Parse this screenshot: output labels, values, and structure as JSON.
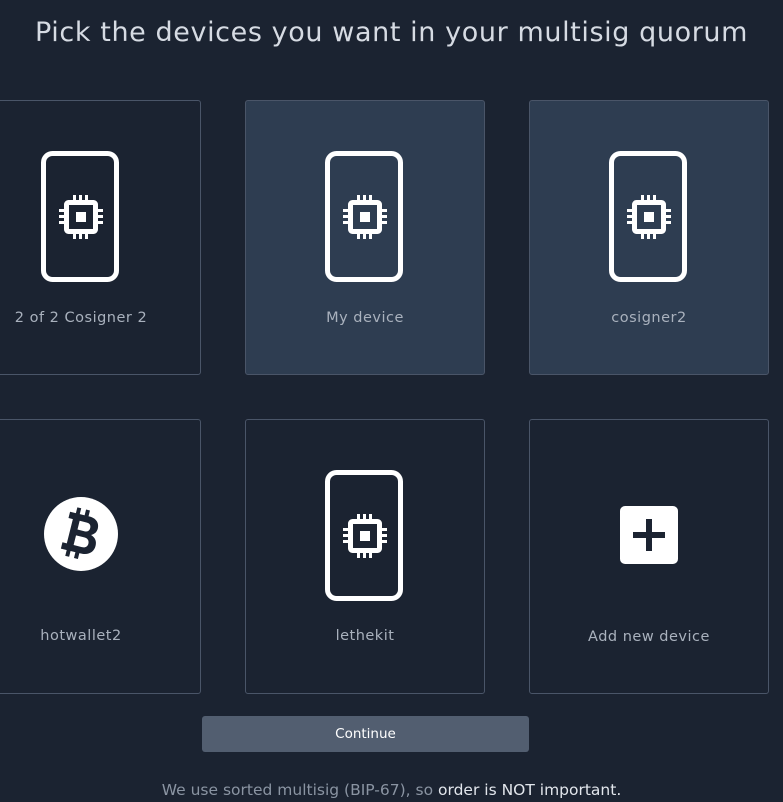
{
  "page": {
    "title": "Pick the devices you want in your multisig quorum"
  },
  "devices": [
    {
      "label": "2 of 2 Cosigner 2",
      "icon": "chip-device-icon",
      "selected": false
    },
    {
      "label": "My device",
      "icon": "chip-device-icon",
      "selected": true
    },
    {
      "label": "cosigner2",
      "icon": "chip-device-icon",
      "selected": true
    },
    {
      "label": "hotwallet2",
      "icon": "bitcoin-icon",
      "selected": false
    },
    {
      "label": "lethekit",
      "icon": "chip-device-icon",
      "selected": false
    },
    {
      "label": "Add new device",
      "icon": "plus-icon",
      "selected": false
    }
  ],
  "actions": {
    "continue_label": "Continue"
  },
  "footer": {
    "note_prefix": "We use sorted multisig (BIP-67), so ",
    "note_emphasis": "order is NOT important."
  },
  "colors": {
    "background": "#1b2331",
    "card_selected": "#2e3d51",
    "card_border": "#4a5568",
    "button": "#525e70",
    "icon": "#ffffff"
  }
}
